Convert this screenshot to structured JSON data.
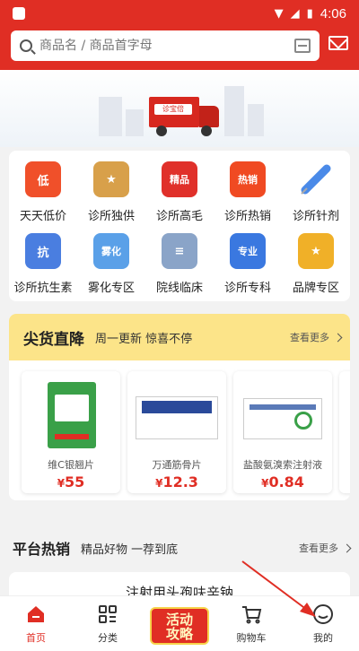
{
  "status_bar": {
    "time": "4:06"
  },
  "search": {
    "placeholder": "商品名 / 商品首字母"
  },
  "banner": {
    "truck_label": "诊宝倍"
  },
  "categories": [
    {
      "label": "天天低价",
      "icon_text": "低",
      "icon": "low-price-icon",
      "color": "#f0502a"
    },
    {
      "label": "诊所独供",
      "icon_text": "★",
      "icon": "medal-icon",
      "color": "#d8a04a"
    },
    {
      "label": "诊所高毛",
      "icon_text": "精品",
      "icon": "trophy-icon",
      "color": "#e0302a"
    },
    {
      "label": "诊所热销",
      "icon_text": "热销",
      "icon": "flame-icon",
      "color": "#f04a22"
    },
    {
      "label": "诊所针剂",
      "icon_text": "",
      "icon": "syringe-icon",
      "color": "#4a8ae8"
    },
    {
      "label": "诊所抗生素",
      "icon_text": "抗",
      "icon": "antibiotic-icon",
      "color": "#4a7ee0"
    },
    {
      "label": "雾化专区",
      "icon_text": "雾化",
      "icon": "nebulizer-icon",
      "color": "#5aa0e8"
    },
    {
      "label": "院线临床",
      "icon_text": "≡",
      "icon": "document-icon",
      "color": "#8aa4c8"
    },
    {
      "label": "诊所专科",
      "icon_text": "专业",
      "icon": "house-icon",
      "color": "#3a78e0"
    },
    {
      "label": "品牌专区",
      "icon_text": "★",
      "icon": "brand-box-icon",
      "color": "#f0b028"
    }
  ],
  "flash_sale": {
    "title": "尖货直降",
    "subtitle": "周一更新 惊喜不停",
    "more": "查看更多",
    "products": [
      {
        "name": "维C银翘片",
        "currency": "¥",
        "price": "55",
        "pic_color": "#3aa048"
      },
      {
        "name": "万通筋骨片",
        "currency": "¥",
        "price": "12.3",
        "pic_color": "#2a4a9a",
        "pic_title": "万通筋骨片"
      },
      {
        "name": "盐酸氨溴索注射液",
        "currency": "¥",
        "price": "0.84",
        "pic_color": "#e0e8f0"
      }
    ]
  },
  "hot": {
    "title": "平台热销",
    "subtitle": "精品好物 一荐到底",
    "more": "查看更多",
    "first_item": "注射用头孢呋辛钠"
  },
  "nav": [
    {
      "label": "首页",
      "icon": "home-icon",
      "active": true
    },
    {
      "label": "分类",
      "icon": "category-grid-icon"
    },
    {
      "label": "活动\n攻略",
      "icon": "promo-icon",
      "promo": true
    },
    {
      "label": "购物车",
      "icon": "cart-icon"
    },
    {
      "label": "我的",
      "icon": "profile-smile-icon"
    }
  ],
  "colors": {
    "brand": "#e02e24",
    "flash_header": "#fce489",
    "annotation_arrow": "#e02e24"
  }
}
